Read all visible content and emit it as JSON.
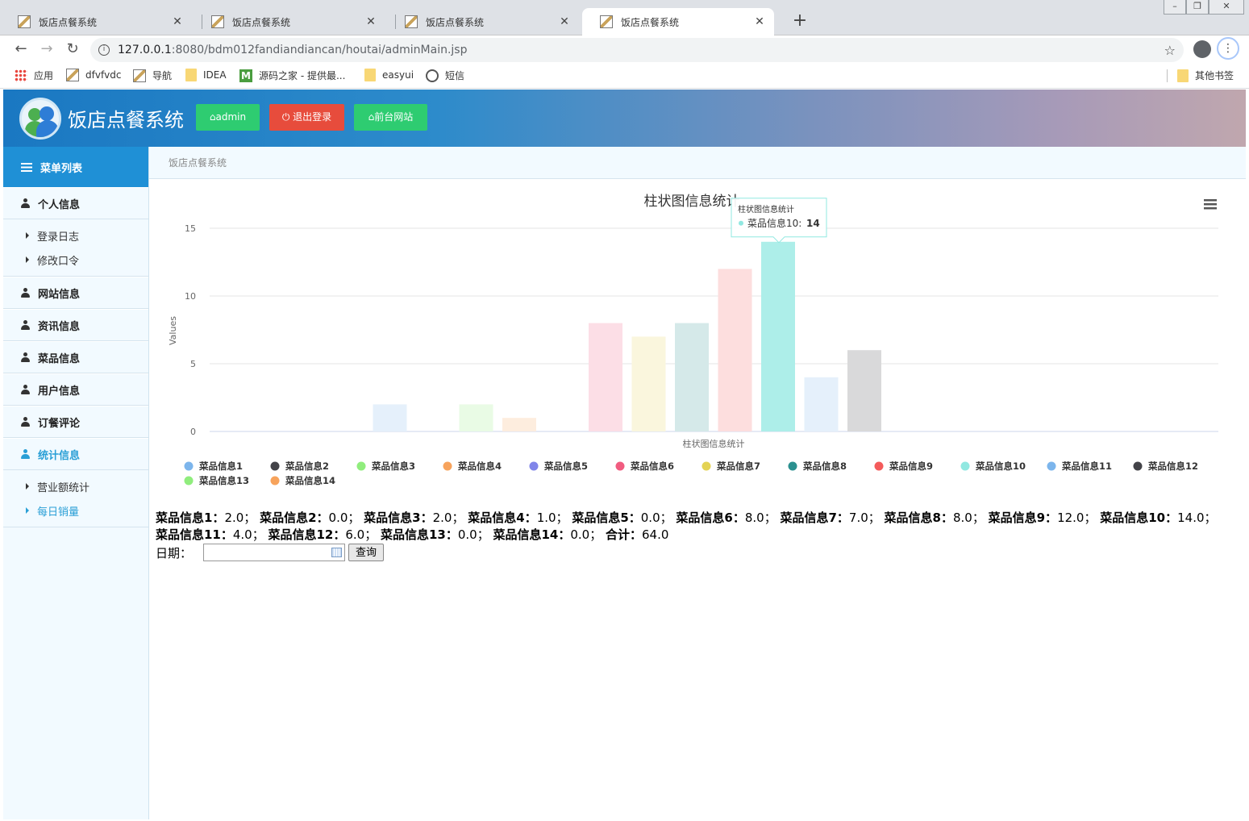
{
  "browser": {
    "tabs": [
      {
        "title": "饭店点餐系统",
        "active": false
      },
      {
        "title": "饭店点餐系统",
        "active": false
      },
      {
        "title": "饭店点餐系统",
        "active": false
      },
      {
        "title": "饭店点餐系统",
        "active": true
      }
    ],
    "address": {
      "host": "127.0.0.1",
      "path": ":8080/bdm012fandiandiancan/houtai/adminMain.jsp"
    },
    "bookmarks": [
      {
        "label": "应用",
        "icon": "apps-icon"
      },
      {
        "label": "dfvfvdc",
        "icon": "page-icon"
      },
      {
        "label": "导航",
        "icon": "page-icon"
      },
      {
        "label": "IDEA",
        "icon": "folder-icon"
      },
      {
        "label": "源码之家 - 提供最...",
        "icon": "m-icon"
      },
      {
        "label": "easyui",
        "icon": "folder-icon"
      },
      {
        "label": "短信",
        "icon": "globe-icon"
      }
    ],
    "other_bookmarks": "其他书签"
  },
  "header": {
    "title": "饭店点餐系统",
    "buttons": {
      "admin": "admin",
      "logout": "退出登录",
      "frontsite": "前台网站"
    }
  },
  "sidebar": {
    "heading": "菜单列表",
    "sections": [
      {
        "label": "个人信息",
        "sub": [
          "登录日志",
          "修改口令"
        ]
      },
      {
        "label": "网站信息"
      },
      {
        "label": "资讯信息"
      },
      {
        "label": "菜品信息"
      },
      {
        "label": "用户信息"
      },
      {
        "label": "订餐评论"
      },
      {
        "label": "统计信息",
        "sub": [
          "营业额统计",
          "每日销量"
        ]
      }
    ]
  },
  "breadcrumb": "饭店点餐系统",
  "chart_data": {
    "type": "bar",
    "title": "柱状图信息统计",
    "xlabel": "柱状图信息统计",
    "ylabel": "Values",
    "ylim": [
      0,
      15
    ],
    "yticks": [
      0,
      5,
      10,
      15
    ],
    "grid": true,
    "legend_position": "bottom",
    "series": [
      {
        "name": "菜品信息1",
        "value": 2,
        "color": "#7cb5ec"
      },
      {
        "name": "菜品信息2",
        "value": 0,
        "color": "#434348"
      },
      {
        "name": "菜品信息3",
        "value": 2,
        "color": "#90ed7d"
      },
      {
        "name": "菜品信息4",
        "value": 1,
        "color": "#f7a35c"
      },
      {
        "name": "菜品信息5",
        "value": 0,
        "color": "#8085e9"
      },
      {
        "name": "菜品信息6",
        "value": 8,
        "color": "#f15c80"
      },
      {
        "name": "菜品信息7",
        "value": 7,
        "color": "#e4d354"
      },
      {
        "name": "菜品信息8",
        "value": 8,
        "color": "#2b908f"
      },
      {
        "name": "菜品信息9",
        "value": 12,
        "color": "#f45b5b"
      },
      {
        "name": "菜品信息10",
        "value": 14,
        "color": "#91e8e1"
      },
      {
        "name": "菜品信息11",
        "value": 4,
        "color": "#7cb5ec"
      },
      {
        "name": "菜品信息12",
        "value": 6,
        "color": "#434348"
      },
      {
        "name": "菜品信息13",
        "value": 0,
        "color": "#90ed7d"
      },
      {
        "name": "菜品信息14",
        "value": 0,
        "color": "#f7a35c"
      }
    ],
    "tooltip": {
      "title": "柱状图信息统计",
      "series": "菜品信息10",
      "value": "14"
    }
  },
  "summary": {
    "items": [
      {
        "k": "菜品信息1：",
        "v": "2.0；"
      },
      {
        "k": "菜品信息2：",
        "v": "0.0；"
      },
      {
        "k": "菜品信息3：",
        "v": "2.0；"
      },
      {
        "k": "菜品信息4：",
        "v": "1.0；"
      },
      {
        "k": "菜品信息5：",
        "v": "0.0；"
      },
      {
        "k": "菜品信息6：",
        "v": "8.0；"
      },
      {
        "k": "菜品信息7：",
        "v": "7.0；"
      },
      {
        "k": "菜品信息8：",
        "v": "8.0；"
      },
      {
        "k": "菜品信息9：",
        "v": "12.0；"
      },
      {
        "k": "菜品信息10：",
        "v": "14.0；"
      },
      {
        "k": "菜品信息11：",
        "v": "4.0；"
      },
      {
        "k": "菜品信息12：",
        "v": "6.0；"
      },
      {
        "k": "菜品信息13：",
        "v": "0.0；"
      },
      {
        "k": "菜品信息14：",
        "v": "0.0；"
      },
      {
        "k": "合计：",
        "v": "64.0"
      }
    ]
  },
  "filter": {
    "date_label": "日期：",
    "date_value": "",
    "query_label": "查询"
  }
}
